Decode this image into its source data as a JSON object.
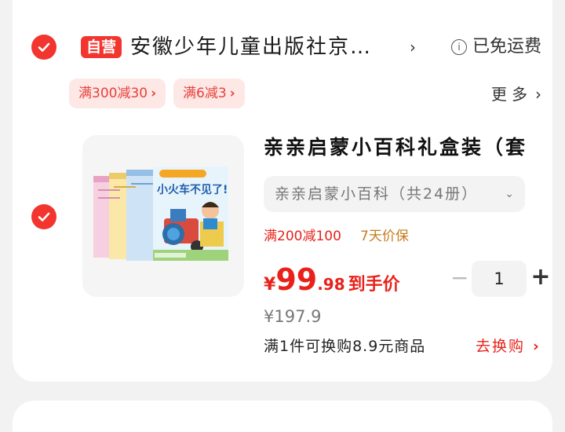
{
  "store": {
    "badge": "自营",
    "name": "安徽少年儿童出版社京…",
    "chevron": "›",
    "info_glyph": "i",
    "shipping": "已免运费"
  },
  "coupons": [
    {
      "label": "满300减30",
      "arrow": "›"
    },
    {
      "label": "满6减3",
      "arrow": "›"
    }
  ],
  "more": {
    "label": "更多",
    "chevron": "›"
  },
  "product": {
    "title": "亲亲启蒙小百科礼盒装（套",
    "variant": "亲亲启蒙小百科（共24册）",
    "variant_chevron": "⌄",
    "promo_discount": "满200减100",
    "promo_guarantee": "7天价保",
    "price_symbol": "¥",
    "price_int": "99",
    "price_dec": ".98",
    "price_label": "到手价",
    "original_price": "¥197.9",
    "quantity": "1",
    "minus": "−",
    "plus": "+",
    "exchange_text": "满1件可换购8.9元商品",
    "exchange_link": "去换购",
    "exchange_arrow": "›",
    "cover_title": "小火车不见了!"
  },
  "colors": {
    "accent": "#f2352e",
    "price": "#e8221a",
    "coupon_bg": "#fde8e6",
    "guarantee": "#c77a1a"
  }
}
